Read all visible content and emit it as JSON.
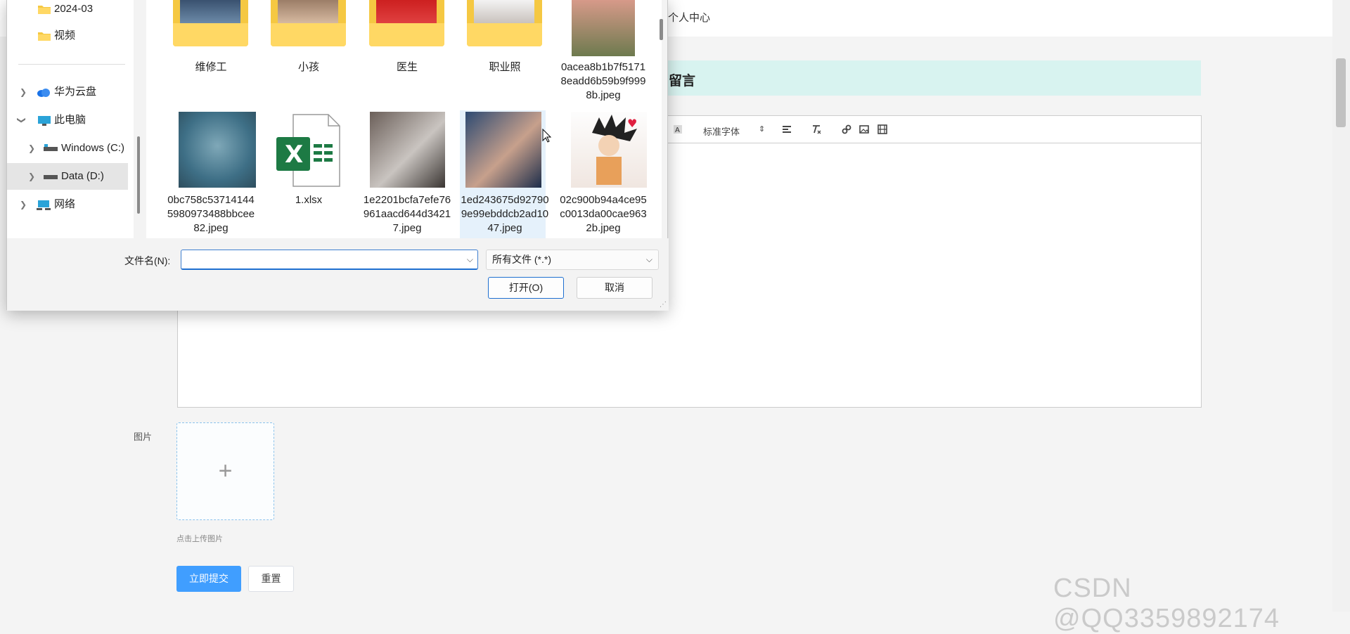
{
  "page": {
    "nav_item": "个人中心",
    "title": "留言",
    "editor": {
      "font_select": "标准字体",
      "font_caret": "⇕"
    },
    "image_label": "图片",
    "upload_plus": "+",
    "upload_hint": "点击上传图片",
    "submit": "立即提交",
    "reset": "重置",
    "watermark": "CSDN @QQ3359892174"
  },
  "dialog": {
    "nav": [
      {
        "label": "2024-03",
        "icon": "folder-icon"
      },
      {
        "label": "视频",
        "icon": "folder-icon"
      },
      {
        "label": "华为云盘",
        "icon": "cloud-icon"
      },
      {
        "label": "此电脑",
        "icon": "computer-icon"
      },
      {
        "label": "Windows (C:)",
        "icon": "drive-icon"
      },
      {
        "label": "Data (D:)",
        "icon": "drive-icon"
      },
      {
        "label": "网络",
        "icon": "network-icon"
      }
    ],
    "files_row1": [
      "维修工",
      "小孩",
      "医生",
      "职业照",
      "0acea8b1b7f51718eadd6b59b9f9998b.jpeg"
    ],
    "files_row2": [
      "0bc758c537141445980973488bbcee82.jpeg",
      "1.xlsx",
      "1e2201bcfa7efe76961aacd644d34217.jpeg",
      "1ed243675d927909e99ebddcb2ad1047.jpeg",
      "02c900b94a4ce95c0013da00cae9632b.jpeg"
    ],
    "filename_label": "文件名(N):",
    "filename_value": "",
    "filetype": "所有文件 (*.*)",
    "open": "打开(O)",
    "cancel": "取消"
  },
  "colors": {
    "accent": "#409eff",
    "title_bg": "#d8f3f0",
    "folder": "#ffd864"
  }
}
